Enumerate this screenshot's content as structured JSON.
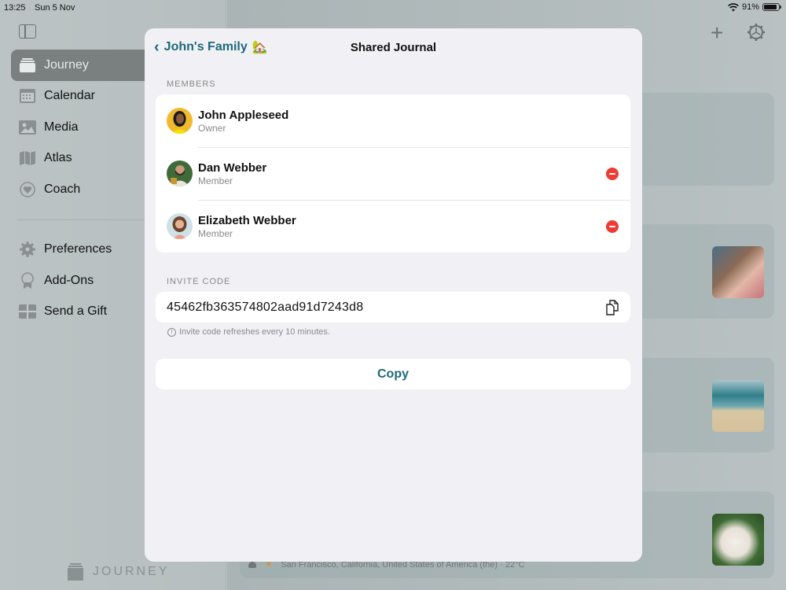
{
  "status_bar": {
    "time": "13:25",
    "date": "Sun 5 Nov",
    "battery_percent_label": "91%",
    "battery_level": 0.91
  },
  "sidebar": {
    "items": [
      {
        "label": "Journey",
        "icon": "journey-icon",
        "active": true
      },
      {
        "label": "Calendar",
        "icon": "calendar-icon",
        "active": false
      },
      {
        "label": "Media",
        "icon": "media-icon",
        "active": false
      },
      {
        "label": "Atlas",
        "icon": "map-icon",
        "active": false
      },
      {
        "label": "Coach",
        "icon": "heart-icon",
        "active": false
      }
    ],
    "secondary_items": [
      {
        "label": "Preferences",
        "icon": "gear-icon"
      },
      {
        "label": "Add-Ons",
        "icon": "award-icon"
      },
      {
        "label": "Send a Gift",
        "icon": "gift-icon"
      }
    ],
    "brand": "JOURNEY"
  },
  "background": {
    "entry_meta": "San Francisco, California, United States of America (the) · 22°C"
  },
  "modal": {
    "back_label": "John's Family",
    "back_emoji": "🏡",
    "title": "Shared Journal",
    "members_section": "MEMBERS",
    "members": [
      {
        "name": "John Appleseed",
        "role": "Owner",
        "removable": false
      },
      {
        "name": "Dan Webber",
        "role": "Member",
        "removable": true
      },
      {
        "name": "Elizabeth Webber",
        "role": "Member",
        "removable": true
      }
    ],
    "invite_section": "INVITE CODE",
    "invite_code": "45462fb363574802aad91d7243d8",
    "invite_note": "Invite code refreshes every 10 minutes.",
    "copy_label": "Copy"
  },
  "colors": {
    "accent": "#1a6a78",
    "destructive": "#ee3b33",
    "modal_bg": "#f1f1f5"
  }
}
